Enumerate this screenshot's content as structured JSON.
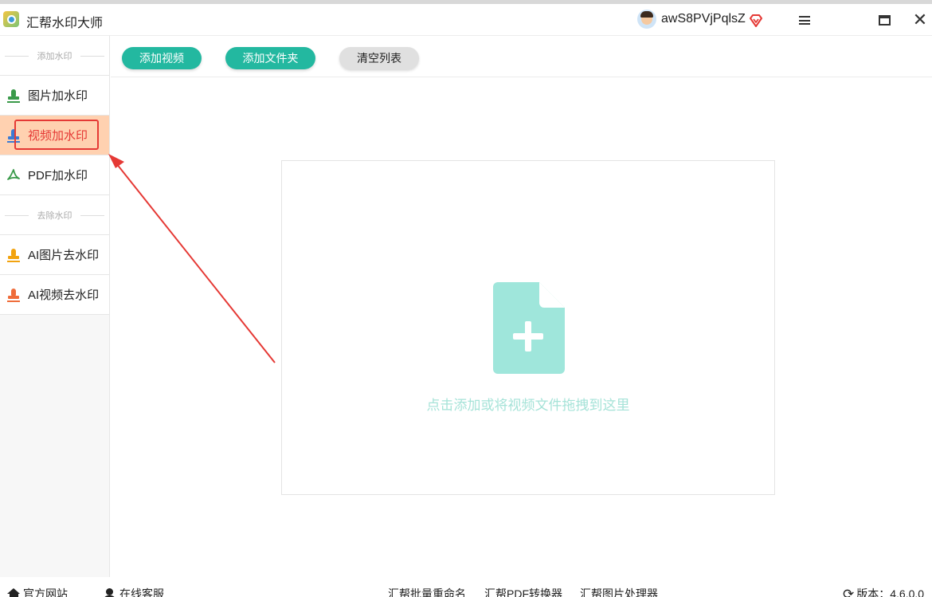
{
  "app": {
    "title": "汇帮水印大师"
  },
  "user": {
    "name": "awS8PVjPqlsZ"
  },
  "sidebar": {
    "add_section": "添加水印",
    "remove_section": "去除水印",
    "items": [
      {
        "label": "图片加水印",
        "icon": "stamp-icon"
      },
      {
        "label": "视频加水印",
        "icon": "stamp-icon",
        "active": true
      },
      {
        "label": "PDF加水印",
        "icon": "pdf-icon"
      },
      {
        "label": "AI图片去水印",
        "icon": "stamp-icon"
      },
      {
        "label": "AI视频去水印",
        "icon": "stamp-icon"
      }
    ]
  },
  "toolbar": {
    "add_video": "添加视频",
    "add_folder": "添加文件夹",
    "clear_list": "清空列表"
  },
  "dropzone": {
    "hint": "点击添加或将视频文件拖拽到这里"
  },
  "footer": {
    "website": "官方网站",
    "support": "在线客服",
    "rename": "汇帮批量重命名",
    "pdf_converter": "汇帮PDF转换器",
    "image_processor": "汇帮图片处理器",
    "version": "版本：4.6.0.0"
  },
  "colors": {
    "accent": "#23b8a0",
    "active_bg": "#ffd1b0",
    "highlight": "#e53935",
    "hint_text": "#a6e3d8",
    "file_icon": "#9fe6db"
  }
}
